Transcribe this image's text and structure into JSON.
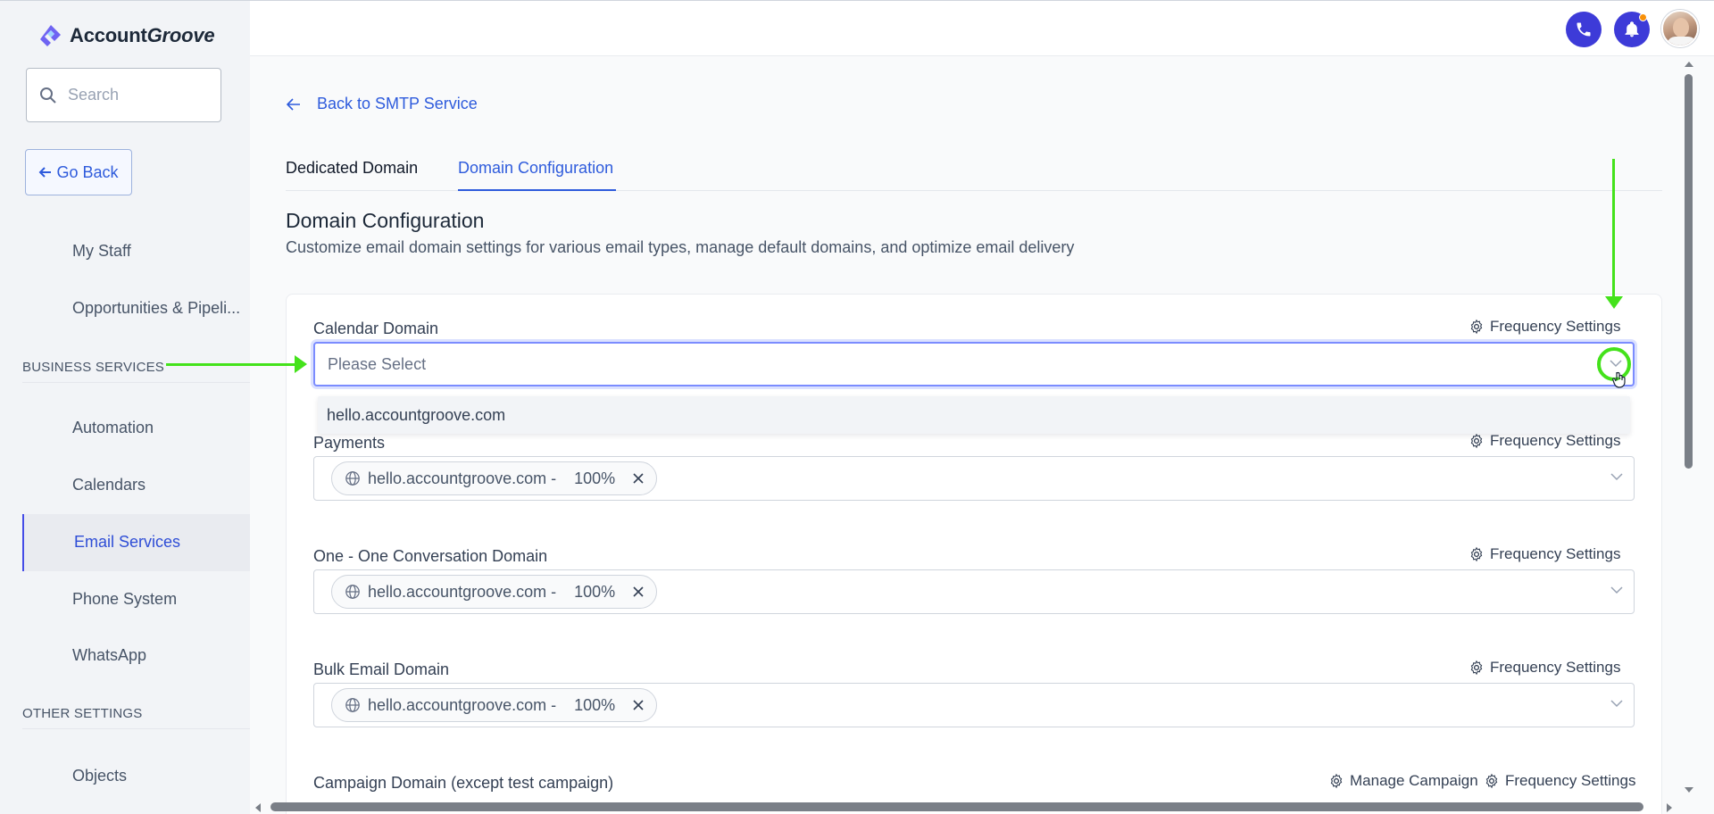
{
  "app": {
    "logo_text_prefix": "Account",
    "logo_text_suffix": "Groove"
  },
  "sidebar": {
    "search_placeholder": "Search",
    "go_back_label": "Go Back",
    "items_top": [
      "My Staff",
      "Opportunities & Pipeli..."
    ],
    "section_business": "BUSINESS SERVICES",
    "business_items": [
      "Automation",
      "Calendars",
      "Email Services",
      "Phone System",
      "WhatsApp"
    ],
    "active_item": "Email Services",
    "section_other": "OTHER SETTINGS",
    "other_items": [
      "Objects"
    ]
  },
  "main": {
    "back_link": "Back to SMTP Service",
    "tabs": [
      {
        "label": "Dedicated Domain",
        "active": false
      },
      {
        "label": "Domain Configuration",
        "active": true
      }
    ],
    "title": "Domain Configuration",
    "subtitle": "Customize email domain settings for various email types, manage default domains, and optimize email delivery",
    "frequency_label": "Frequency Settings",
    "manage_campaign_label": "Manage Campaign",
    "fields": [
      {
        "label": "Calendar Domain",
        "placeholder": "Please Select"
      },
      {
        "label": "Payments",
        "chip_domain": "hello.accountgroove.com -",
        "chip_pct": "100%"
      },
      {
        "label": "One - One Conversation Domain",
        "chip_domain": "hello.accountgroove.com -",
        "chip_pct": "100%"
      },
      {
        "label": "Bulk Email Domain",
        "chip_domain": "hello.accountgroove.com -",
        "chip_pct": "100%"
      },
      {
        "label": "Campaign Domain (except test campaign)"
      }
    ],
    "dropdown_option": "hello.accountgroove.com"
  },
  "colors": {
    "accent": "#2e5bdc",
    "topbar_button": "#3d3bd8",
    "annotation": "#44e21b"
  },
  "icons": {
    "phone": "phone-icon",
    "bell": "bell-icon",
    "gear": "gear-icon",
    "globe": "globe-icon",
    "close": "close-icon",
    "chevron": "chevron-down-icon",
    "search": "search-icon",
    "arrow_left": "arrow-left-icon"
  }
}
